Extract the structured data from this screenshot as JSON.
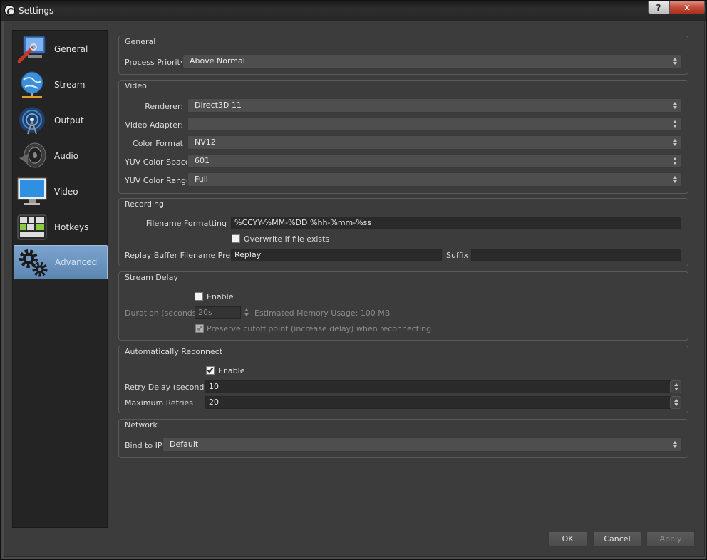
{
  "window": {
    "title": "Settings",
    "help_glyph": "?",
    "close_glyph": "✕"
  },
  "sidebar": {
    "items": [
      {
        "label": "General",
        "icon": "wrench-computer-icon",
        "selected": false
      },
      {
        "label": "Stream",
        "icon": "globe-network-icon",
        "selected": false
      },
      {
        "label": "Output",
        "icon": "broadcast-icon",
        "selected": false
      },
      {
        "label": "Audio",
        "icon": "speaker-icon",
        "selected": false
      },
      {
        "label": "Video",
        "icon": "monitor-icon",
        "selected": false
      },
      {
        "label": "Hotkeys",
        "icon": "keyboard-icon",
        "selected": false
      },
      {
        "label": "Advanced",
        "icon": "gears-icon",
        "selected": true
      }
    ]
  },
  "general": {
    "title": "General",
    "process_priority_label": "Process Priority",
    "process_priority_value": "Above Normal"
  },
  "video": {
    "title": "Video",
    "renderer_label": "Renderer:",
    "renderer_value": "Direct3D 11",
    "adapter_label": "Video Adapter:",
    "adapter_value": "",
    "color_format_label": "Color Format",
    "color_format_value": "NV12",
    "yuv_space_label": "YUV Color Space",
    "yuv_space_value": "601",
    "yuv_range_label": "YUV Color Range",
    "yuv_range_value": "Full"
  },
  "recording": {
    "title": "Recording",
    "filename_label": "Filename Formatting",
    "filename_value": "%CCYY-%MM-%DD %hh-%mm-%ss",
    "overwrite_label": "Overwrite if file exists",
    "overwrite_checked": false,
    "replay_prefix_label": "Replay Buffer Filename Prefix",
    "replay_prefix_value": "Replay",
    "suffix_label": "Suffix",
    "suffix_value": ""
  },
  "stream_delay": {
    "title": "Stream Delay",
    "enable_label": "Enable",
    "enable_checked": false,
    "duration_label": "Duration (seconds)",
    "duration_value": "20s",
    "memory_label": "Estimated Memory Usage: 100 MB",
    "preserve_label": "Preserve cutoff point (increase delay) when reconnecting",
    "preserve_checked": true
  },
  "auto_reconnect": {
    "title": "Automatically Reconnect",
    "enable_label": "Enable",
    "enable_checked": true,
    "retry_delay_label": "Retry Delay (seconds)",
    "retry_delay_value": "10",
    "max_retries_label": "Maximum Retries",
    "max_retries_value": "20"
  },
  "network": {
    "title": "Network",
    "bind_label": "Bind to IP",
    "bind_value": "Default"
  },
  "footer": {
    "ok_label": "OK",
    "cancel_label": "Cancel",
    "apply_label": "Apply"
  }
}
